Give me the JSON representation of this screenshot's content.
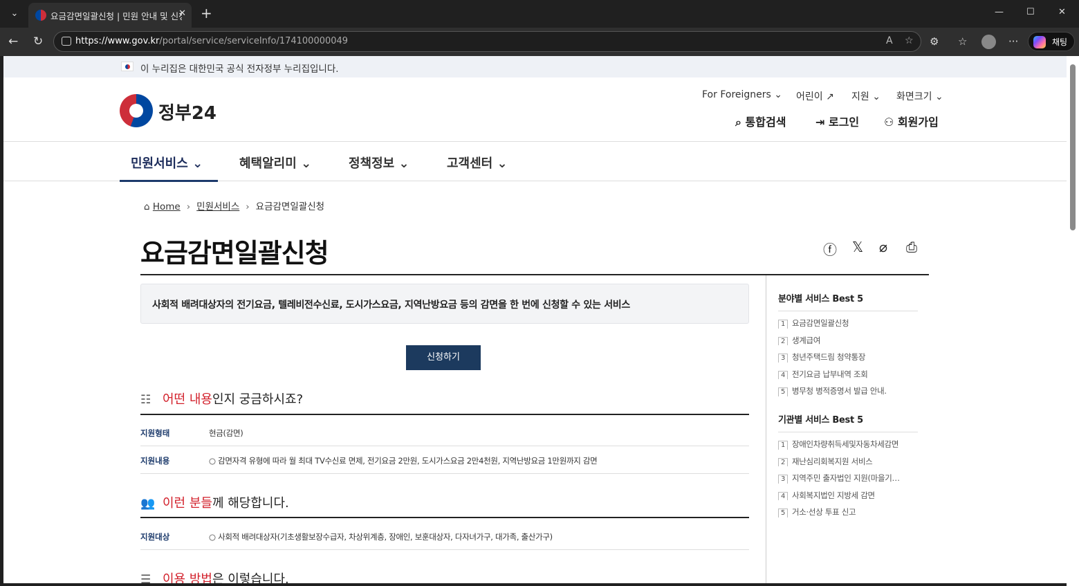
{
  "browser": {
    "tab_title": "요금감면일괄신청 | 민원 안내 및 신청",
    "url_host": "https://www.gov.kr",
    "url_path": "/portal/service/serviceInfo/174100000049",
    "copilot_label": "채팅"
  },
  "notice": {
    "text": "이 누리집은 대한민국 공식 전자정부 누리집입니다."
  },
  "header": {
    "logo_text": "정부24",
    "util_links": [
      "For Foreigners",
      "어린이",
      "지원",
      "화면크기"
    ],
    "actions": {
      "search": "통합검색",
      "login": "로그인",
      "signup": "회원가입"
    }
  },
  "gnb": {
    "items": [
      "민원서비스",
      "혜택알리미",
      "정책정보",
      "고객센터"
    ],
    "active": "민원서비스"
  },
  "breadcrumb": {
    "home": "Home",
    "level1": "민원서비스",
    "current": "요금감면일괄신청"
  },
  "page_title": "요금감면일괄신청",
  "summary": "사회적 배려대상자의 전기요금, 텔레비전수신료, 도시가스요금, 지역난방요금 등의 감면을 한 번에 신청할 수 있는 서비스",
  "apply_button": "신청하기",
  "sections": {
    "what": {
      "title_hl": "어떤 내용",
      "title_rest": "인지 궁금하시죠?",
      "rows": [
        {
          "key": "지원형태",
          "value": "현금(감면)"
        },
        {
          "key": "지원내용",
          "value": "○ 감면자격 유형에 따라 월 최대 TV수신료 면제, 전기요금 2만원, 도시가스요금 2만4천원, 지역난방요금 1만원까지 감면"
        }
      ]
    },
    "who": {
      "title_hl": "이런 분들",
      "title_rest": "께 해당합니다.",
      "rows": [
        {
          "key": "지원대상",
          "value": "○ 사회적 배려대상자(기초생활보장수급자, 차상위계층, 장애인, 보훈대상자, 다자녀가구, 대가족, 출산가구)"
        }
      ]
    },
    "how": {
      "title_hl": "이용 방법",
      "title_rest": "은 이렇습니다."
    }
  },
  "sidebar": {
    "best_field": {
      "title": "분야별 서비스 Best 5",
      "items": [
        "요금감면일괄신청",
        "생계급여",
        "청년주택드림 청약통장",
        "전기요금 납부내역 조회",
        "병무청 병적증명서 발급 안내."
      ]
    },
    "best_agency": {
      "title": "기관별 서비스 Best 5",
      "items": [
        "장애인차량취득세및자동차세감면",
        "재난심리회복지원 서비스",
        "지역주민 출자법인 지원(마을기…",
        "사회복지법인 지방세 감면",
        "거소·선상 투표 신고"
      ]
    }
  }
}
